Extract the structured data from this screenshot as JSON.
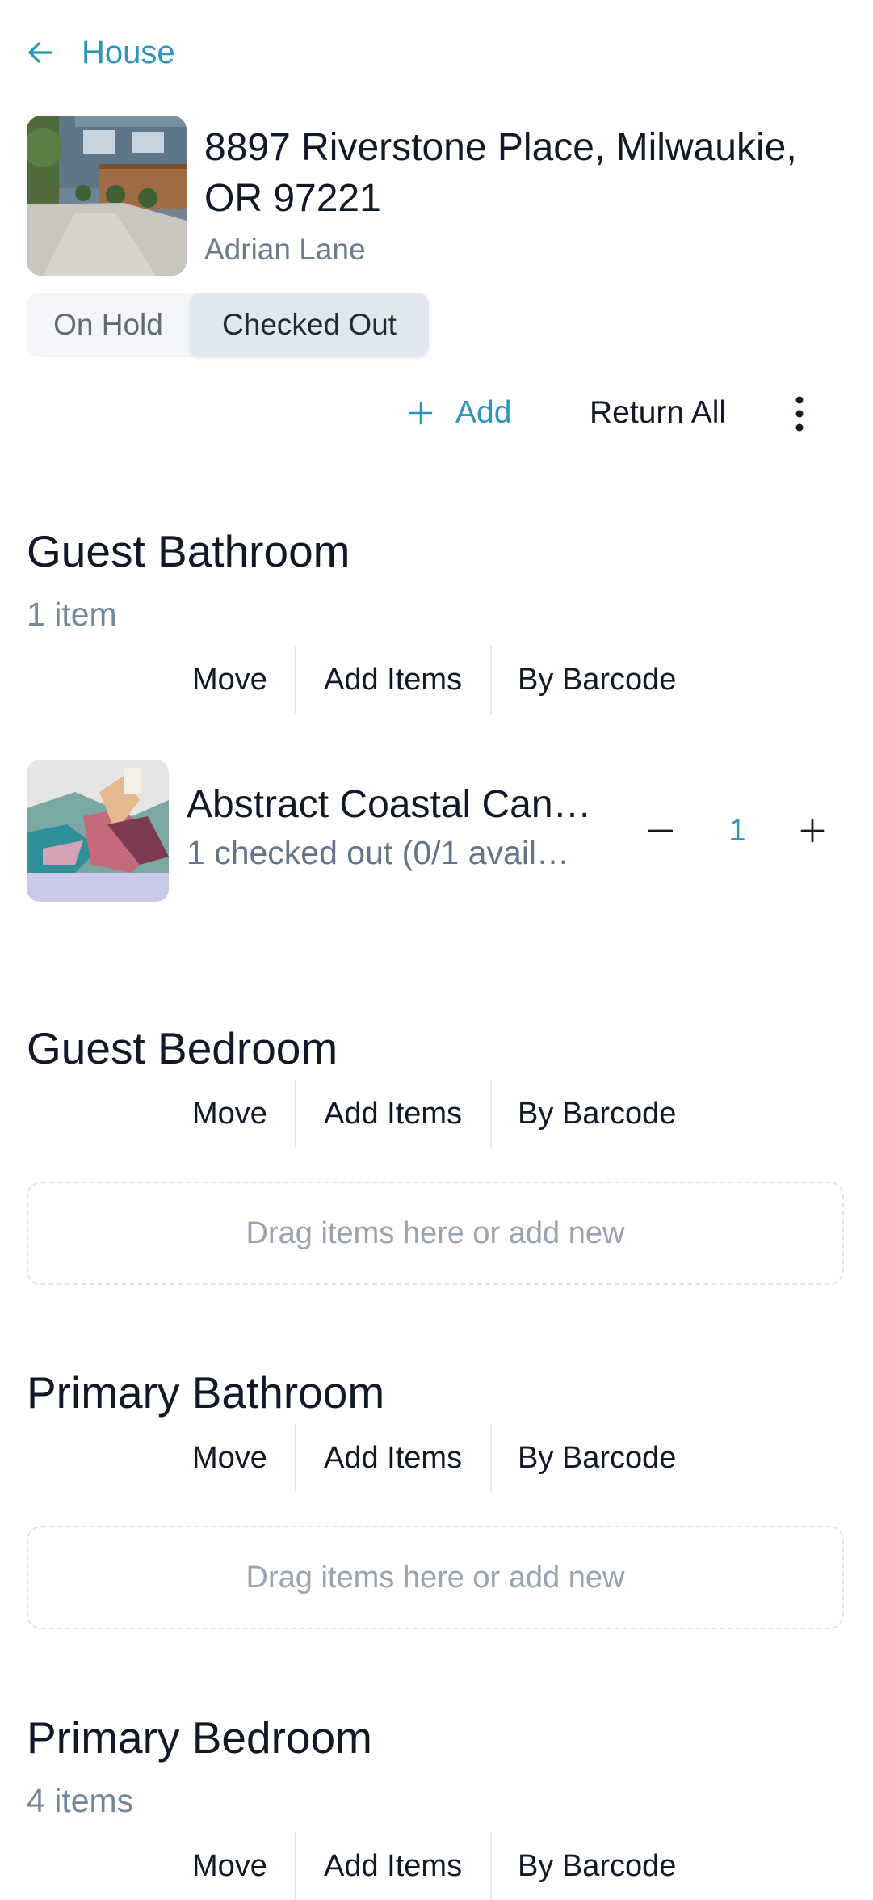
{
  "header": {
    "back_label": "House"
  },
  "property": {
    "address": "8897 Riverstone Place, Milwaukie, OR 97221",
    "owner": "Adrian Lane"
  },
  "tabs": [
    {
      "label": "On Hold",
      "active": false
    },
    {
      "label": "Checked Out",
      "active": true
    }
  ],
  "actions": {
    "add_label": "Add",
    "return_all_label": "Return All"
  },
  "room_tools": {
    "move": "Move",
    "add_items": "Add Items",
    "by_barcode": "By Barcode"
  },
  "dropzone_text": "Drag items here or add new",
  "rooms": [
    {
      "name": "Guest Bathroom",
      "count": "1 item",
      "items": [
        {
          "name": "Abstract Coastal Can…",
          "status": "1 checked out (0/1 avail…",
          "quantity": "1"
        }
      ]
    },
    {
      "name": "Guest Bedroom"
    },
    {
      "name": "Primary Bathroom"
    },
    {
      "name": "Primary Bedroom",
      "count": "4 items"
    }
  ],
  "colors": {
    "accent": "#2b95bb",
    "muted_text": "#74869a"
  }
}
